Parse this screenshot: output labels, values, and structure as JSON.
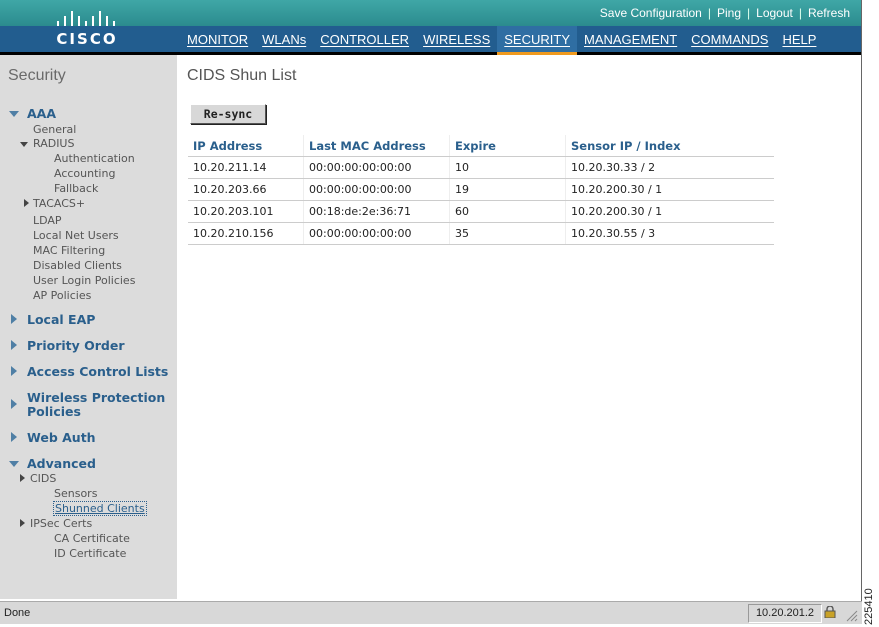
{
  "brand": {
    "logo_text": "CISCO"
  },
  "utility_links": [
    "Save Configuration",
    "Ping",
    "Logout",
    "Refresh"
  ],
  "nav": {
    "items": [
      "MONITOR",
      "WLANs",
      "CONTROLLER",
      "WIRELESS",
      "SECURITY",
      "MANAGEMENT",
      "COMMANDS",
      "HELP"
    ],
    "active": "SECURITY"
  },
  "sidebar": {
    "title": "Security",
    "aaa": "AAA",
    "general": "General",
    "radius": "RADIUS",
    "authentication": "Authentication",
    "accounting": "Accounting",
    "fallback": "Fallback",
    "tacacs": "TACACS+",
    "ldap": "LDAP",
    "local_net_users": "Local Net Users",
    "mac_filtering": "MAC Filtering",
    "disabled_clients": "Disabled Clients",
    "user_login_policies": "User Login Policies",
    "ap_policies": "AP Policies",
    "local_eap": "Local EAP",
    "priority_order": "Priority Order",
    "access_control_lists": "Access Control Lists",
    "wireless_protection_1": "Wireless Protection",
    "wireless_protection_2": "Policies",
    "web_auth": "Web Auth",
    "advanced": "Advanced",
    "cids": "CIDS",
    "sensors": "Sensors",
    "shunned_clients": "Shunned Clients",
    "ipsec_certs": "IPSec Certs",
    "ca_certificate": "CA Certificate",
    "id_certificate": "ID Certificate"
  },
  "main": {
    "title": "CIDS Shun List",
    "resync_label": "Re-sync",
    "columns": [
      "IP Address",
      "Last MAC Address",
      "Expire",
      "Sensor IP / Index"
    ],
    "rows": [
      [
        "10.20.211.14",
        "00:00:00:00:00:00",
        "10",
        "10.20.30.33 / 2"
      ],
      [
        "10.20.203.66",
        "00:00:00:00:00:00",
        "19",
        "10.20.200.30 / 1"
      ],
      [
        "10.20.203.101",
        "00:18:de:2e:36:71",
        "60",
        "10.20.200.30 / 1"
      ],
      [
        "10.20.210.156",
        "00:00:00:00:00:00",
        "35",
        "10.20.30.55 / 3"
      ]
    ]
  },
  "status": {
    "text": "Done",
    "ip": "10.20.201.2"
  },
  "figure_number": "225410"
}
